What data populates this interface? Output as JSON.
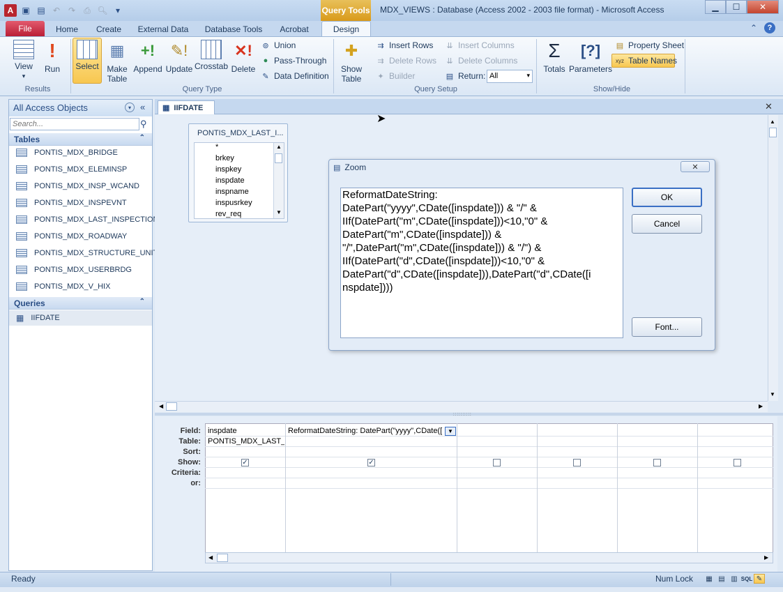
{
  "window": {
    "title": "MDX_VIEWS : Database (Access 2002 - 2003 file format)  -  Microsoft Access",
    "context_tab": "Query Tools",
    "minimize": "▁",
    "maximize": "☐",
    "close": "✕"
  },
  "tabs": [
    "File",
    "Home",
    "Create",
    "External Data",
    "Database Tools",
    "Acrobat",
    "Design"
  ],
  "ribbon": {
    "results": {
      "group": "Results",
      "view": "View",
      "run": "Run"
    },
    "query_type": {
      "group": "Query Type",
      "select": "Select",
      "make_table": "Make Table",
      "append": "Append",
      "update": "Update",
      "crosstab": "Crosstab",
      "delete": "Delete",
      "union": "Union",
      "pass_through": "Pass-Through",
      "data_definition": "Data Definition"
    },
    "query_setup": {
      "group": "Query Setup",
      "show_table": "Show Table",
      "insert_rows": "Insert Rows",
      "delete_rows": "Delete Rows",
      "builder": "Builder",
      "insert_columns": "Insert Columns",
      "delete_columns": "Delete Columns",
      "return_label": "Return:",
      "return_value": "All"
    },
    "show_hide": {
      "group": "Show/Hide",
      "totals": "Totals",
      "parameters": "Parameters",
      "property_sheet": "Property Sheet",
      "table_names": "Table Names"
    }
  },
  "nav": {
    "header": "All Access Objects",
    "search_placeholder": "Search...",
    "tables_header": "Tables",
    "tables": [
      "PONTIS_MDX_BRIDGE",
      "PONTIS_MDX_ELEMINSP",
      "PONTIS_MDX_INSP_WCAND",
      "PONTIS_MDX_INSPEVNT",
      "PONTIS_MDX_LAST_INSPECTION",
      "PONTIS_MDX_ROADWAY",
      "PONTIS_MDX_STRUCTURE_UNIT",
      "PONTIS_MDX_USERBRDG",
      "PONTIS_MDX_V_HIX"
    ],
    "queries_header": "Queries",
    "queries": [
      "IIFDATE"
    ]
  },
  "document": {
    "tab_title": "IIFDATE",
    "table_box": {
      "title": "PONTIS_MDX_LAST_I...",
      "fields": [
        "*",
        "brkey",
        "inspkey",
        "inspdate",
        "inspname",
        "inspusrkey",
        "rev_req"
      ]
    }
  },
  "zoom": {
    "title": "Zoom",
    "text": "ReformatDateString:\nDatePart(\"yyyy\",CDate([inspdate])) & \"/\" &\nIIf(DatePart(\"m\",CDate([inspdate]))<10,\"0\" &\nDatePart(\"m\",CDate([inspdate])) &\n\"/\",DatePart(\"m\",CDate([inspdate])) & \"/\") &\nIIf(DatePart(\"d\",CDate([inspdate]))<10,\"0\" &\nDatePart(\"d\",CDate([inspdate])),DatePart(\"d\",CDate([i\nnspdate])))",
    "ok": "OK",
    "cancel": "Cancel",
    "font": "Font..."
  },
  "grid": {
    "row_labels": [
      "Field:",
      "Table:",
      "Sort:",
      "Show:",
      "Criteria:",
      "or:"
    ],
    "col1": {
      "field": "inspdate",
      "table": "PONTIS_MDX_LAST_IN"
    },
    "col2": {
      "field": "ReformatDateString: DatePart(\"yyyy\",CDate(["
    },
    "show": [
      true,
      true,
      false,
      false,
      false,
      false
    ]
  },
  "status": {
    "text": "Ready",
    "num_lock": "Num Lock"
  }
}
